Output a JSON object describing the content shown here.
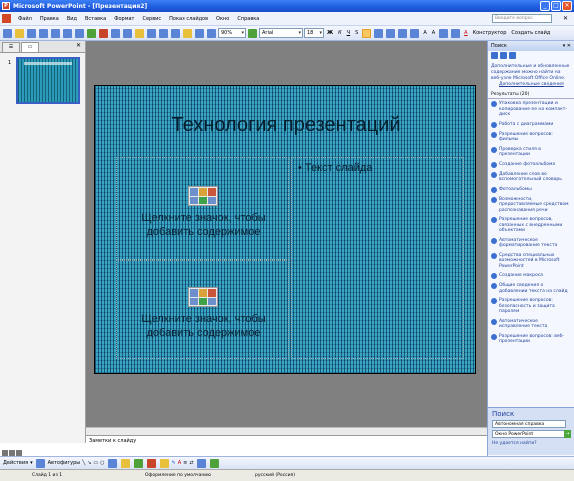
{
  "window": {
    "title": "Microsoft PowerPoint - [Презентация2]"
  },
  "menu": {
    "items": [
      "Файл",
      "Правка",
      "Вид",
      "Вставка",
      "Формат",
      "Сервис",
      "Показ слайдов",
      "Окно",
      "Справка"
    ],
    "help_placeholder": "Введите вопрос"
  },
  "toolbar": {
    "zoom": "90%",
    "font": "Arial",
    "font_size": "18",
    "designer_label": "Конструктор",
    "new_slide_label": "Создать слайд"
  },
  "left_panel": {
    "slide_number": "1"
  },
  "slide": {
    "title": "Технология презентаций",
    "placeholder1": "Щелкните значок, чтобы добавить содержимое",
    "placeholder2": "Щелкните значок, чтобы добавить содержимое",
    "bullet": "Текст слайда"
  },
  "notes": {
    "placeholder": "Заметки к слайду"
  },
  "taskpane": {
    "title": "Поиск",
    "info": "Дополнительные и обновленные содержание можно найти на веб-узле Microsoft Office Online.",
    "info_link": "Дополнительные сведения",
    "results_label": "Результаты (20)",
    "results": [
      "Упаковка презентации и копирование ее на компакт-диск",
      "Работа с диаграммами",
      "Разрешение вопросов: фильмы",
      "Проверка стиля в презентации",
      "Создание фотоальбома",
      "Добавление слов во вспомогательный словарь",
      "Фотоальбомы",
      "Возможности, предоставляемые средством распознавания речи",
      "Разрешение вопросов, связанных с внедренными объектами",
      "Автоматическое форматирование текста",
      "Средства специальных возможностей в Microsoft PowerPoint",
      "Создание макроса",
      "Общие сведения о добавлении текста на слайд",
      "Разрешение вопросов: безопасность и защита паролем",
      "Автоматическое исправление текста",
      "Разрешение вопросов: веб-презентации"
    ],
    "search_label": "Поиск",
    "search_scope": "Автономная справка",
    "search_value": "Окно PowerPoint",
    "no_result_link": "Не удается найти?"
  },
  "drawbar": {
    "actions_label": "Действия",
    "autoshapes_label": "Автофигуры"
  },
  "status": {
    "slide": "Слайд 1 из 1",
    "design": "Оформление по умолчанию",
    "language": "русский (Россия)"
  }
}
